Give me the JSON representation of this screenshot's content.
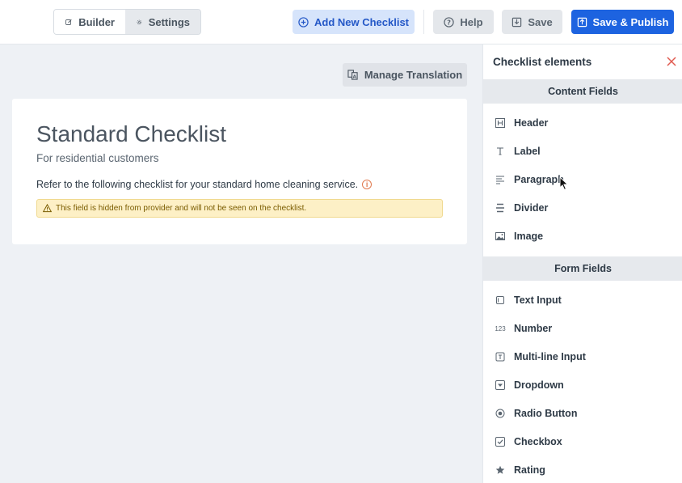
{
  "toolbar": {
    "builder_label": "Builder",
    "settings_label": "Settings",
    "add_label": "Add New Checklist",
    "help_label": "Help",
    "save_label": "Save",
    "publish_label": "Save & Publish",
    "translate_label": "Manage Translation"
  },
  "checklist": {
    "title": "Standard Checklist",
    "subtitle": "For residential customers",
    "description": "Refer to the following checklist for your standard home cleaning service.",
    "hidden_warning": "This field is hidden from provider and will not be seen on the checklist."
  },
  "panel": {
    "title": "Checklist elements",
    "content_section": "Content Fields",
    "form_section": "Form Fields",
    "content_items": [
      {
        "label": "Header",
        "icon": "header-icon"
      },
      {
        "label": "Label",
        "icon": "text-icon"
      },
      {
        "label": "Paragraph",
        "icon": "paragraph-icon"
      },
      {
        "label": "Divider",
        "icon": "divider-icon"
      },
      {
        "label": "Image",
        "icon": "image-icon"
      }
    ],
    "form_items": [
      {
        "label": "Text Input",
        "icon": "text-input-icon"
      },
      {
        "label": "Number",
        "icon": "number-icon"
      },
      {
        "label": "Multi-line Input",
        "icon": "multiline-icon"
      },
      {
        "label": "Dropdown",
        "icon": "dropdown-icon"
      },
      {
        "label": "Radio Button",
        "icon": "radio-icon"
      },
      {
        "label": "Checkbox",
        "icon": "checkbox-icon"
      },
      {
        "label": "Rating",
        "icon": "rating-icon"
      }
    ]
  },
  "colors": {
    "primary": "#1d63e0",
    "primary_light": "#d6e4fb",
    "warning_bg": "#fdf0c6",
    "close": "#e05a4f"
  }
}
